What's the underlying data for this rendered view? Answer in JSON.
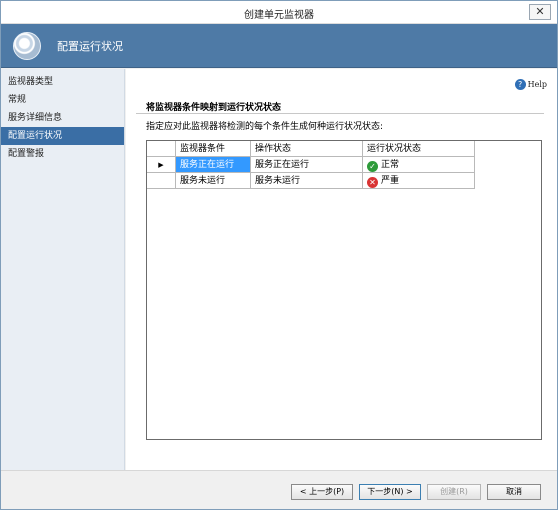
{
  "window": {
    "title": "创建单元监视器",
    "close_icon": "close-icon"
  },
  "header": {
    "heading": "配置运行状况",
    "logo_icon": "wizard-logo-icon"
  },
  "sidebar": {
    "items": [
      {
        "label": "监视器类型"
      },
      {
        "label": "常规"
      },
      {
        "label": "服务详细信息"
      },
      {
        "label": "配置运行状况",
        "active": true
      },
      {
        "label": "配置警报"
      }
    ]
  },
  "content": {
    "help_label": "Help",
    "section_title": "将监视器条件映射到运行状况状态",
    "instruction": "指定应对此监视器将检测的每个条件生成何种运行状况状态:",
    "table": {
      "headers": [
        "监视器条件",
        "操作状态",
        "运行状况状态"
      ],
      "rows": [
        {
          "condition": "服务正在运行",
          "operational_state": "服务正在运行",
          "health_state": "正常",
          "health_icon": "check-circle-icon",
          "selected": true
        },
        {
          "condition": "服务未运行",
          "operational_state": "服务未运行",
          "health_state": "严重",
          "health_icon": "error-circle-icon",
          "selected": false
        }
      ]
    }
  },
  "footer": {
    "back_label": "< 上一步(P)",
    "next_label": "下一步(N) >",
    "create_label": "创建(R)",
    "cancel_label": "取消"
  },
  "colors": {
    "header_bg": "#4e7aa6",
    "sidebar_active": "#3a6ea5",
    "selection": "#3399ff",
    "ok": "#2e9b3a",
    "critical": "#d93434"
  }
}
